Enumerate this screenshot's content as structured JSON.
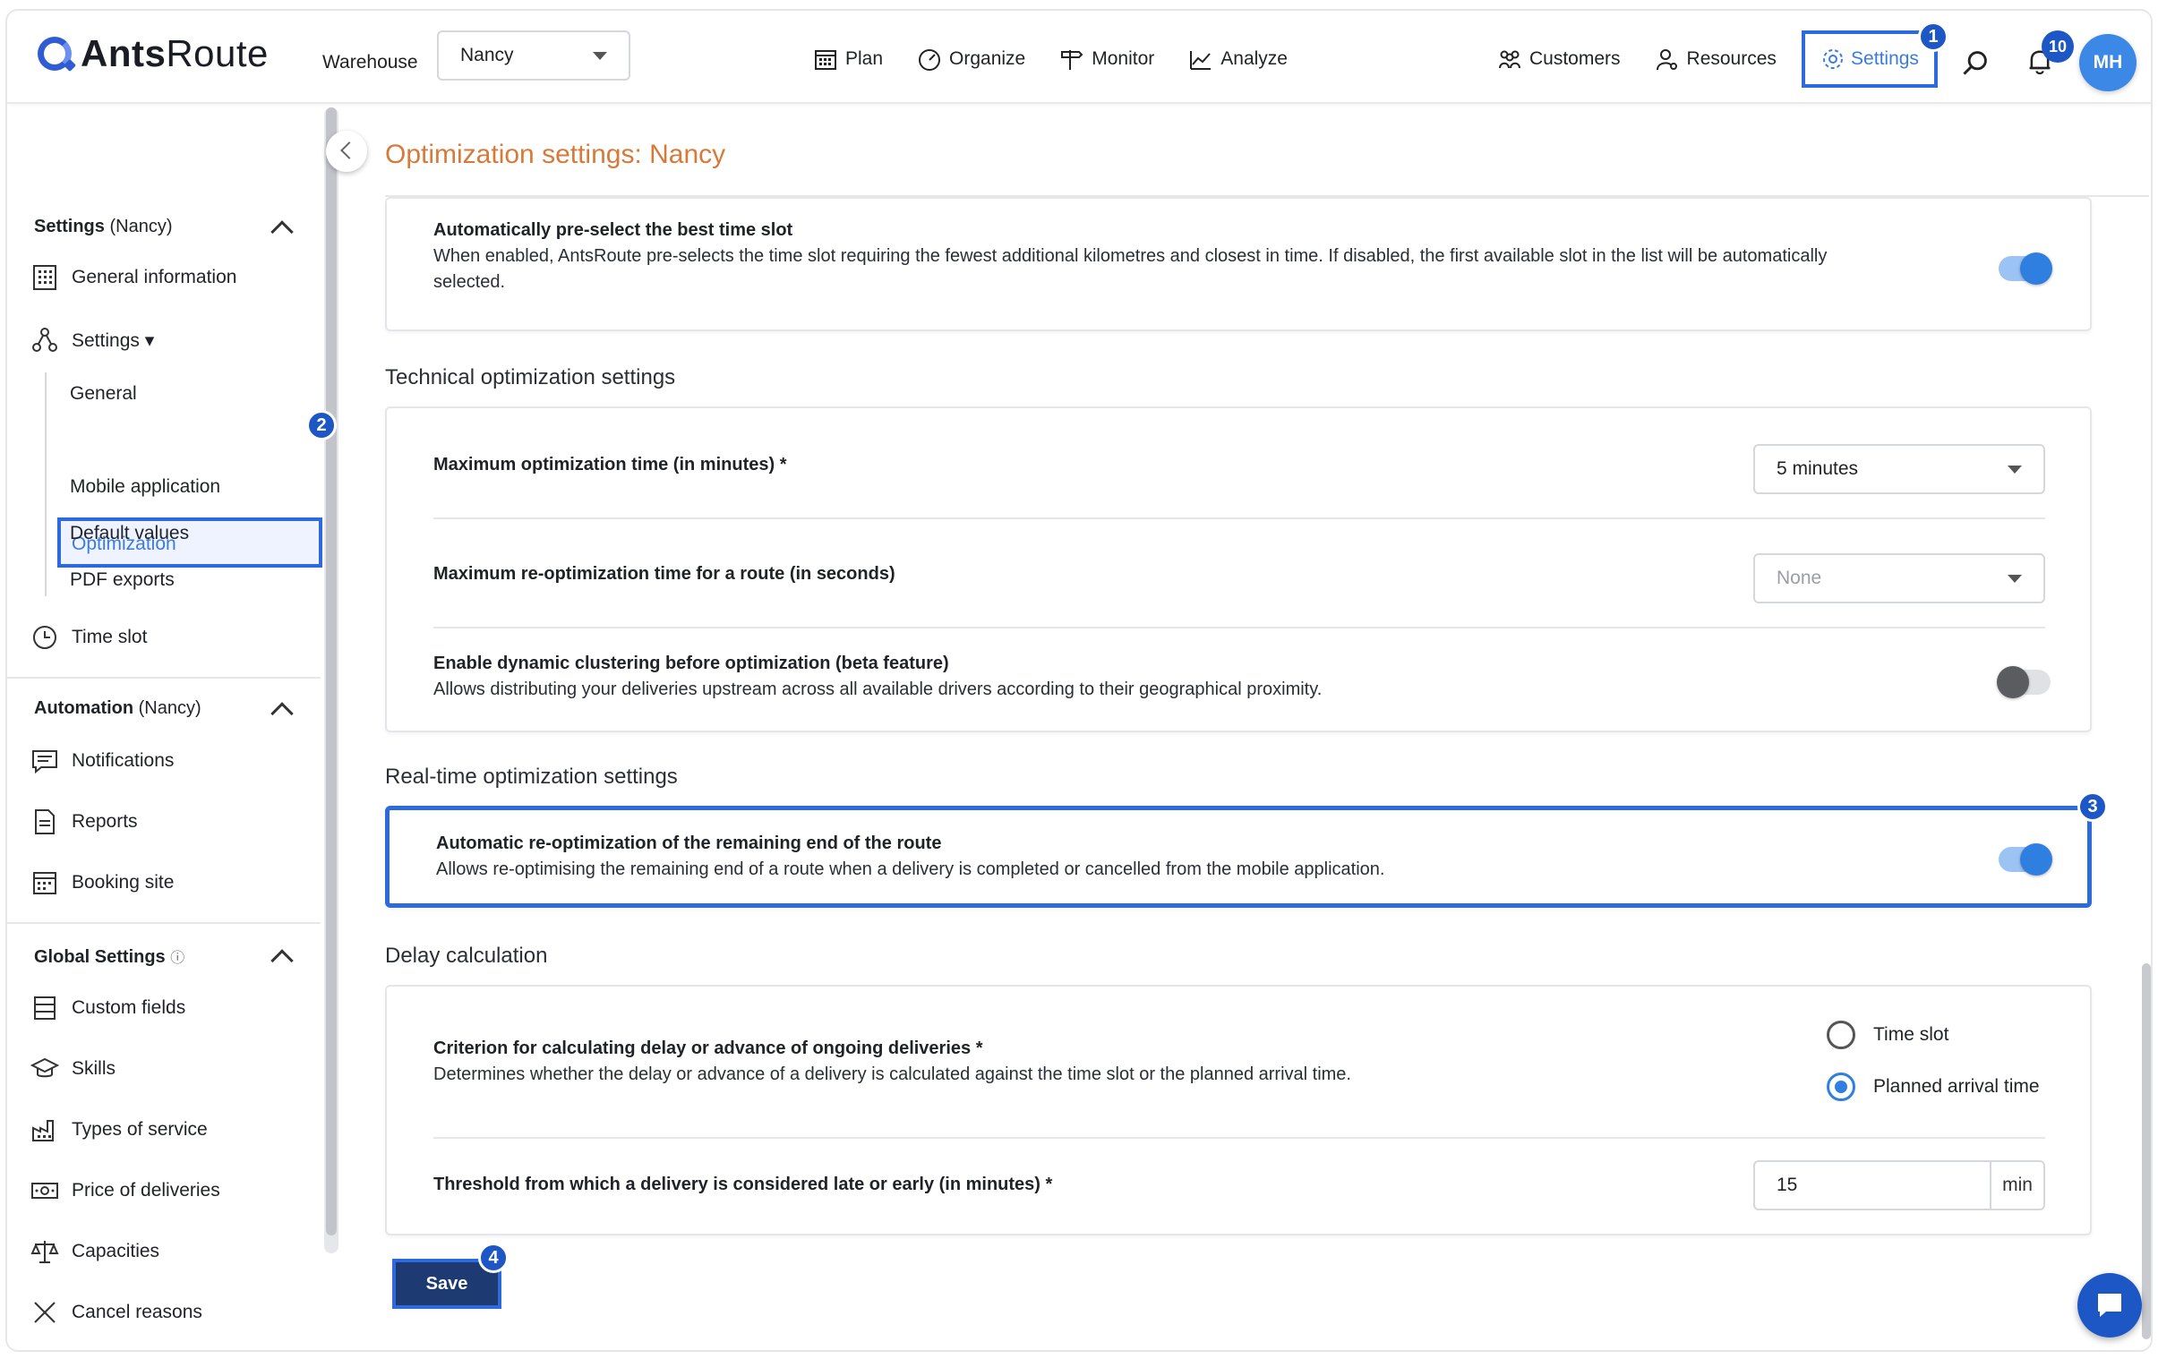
{
  "brand": {
    "name_bold": "Ants",
    "name_rest": "Route"
  },
  "topbar": {
    "warehouse_label": "Warehouse",
    "warehouse_value": "Nancy",
    "nav": [
      {
        "label": "Plan",
        "icon": "calendar-icon"
      },
      {
        "label": "Organize",
        "icon": "gauge-icon"
      },
      {
        "label": "Monitor",
        "icon": "signpost-icon"
      },
      {
        "label": "Analyze",
        "icon": "chart-icon"
      }
    ],
    "right_nav": [
      {
        "label": "Customers",
        "icon": "customers-icon"
      },
      {
        "label": "Resources",
        "icon": "resources-icon"
      }
    ],
    "settings_label": "Settings",
    "notifications_count": "10",
    "avatar_initials": "MH"
  },
  "steps": {
    "s1": "1",
    "s2": "2",
    "s3": "3",
    "s4": "4"
  },
  "sidebar": {
    "settings_head_bold": "Settings",
    "settings_head_rest": " (Nancy)",
    "general_information": "General information",
    "settings_group": "Settings ▾",
    "sub_items": [
      "General",
      "Optimization",
      "Mobile application",
      "Default values",
      "PDF exports"
    ],
    "time_slot": "Time slot",
    "automation_head_bold": "Automation",
    "automation_head_rest": " (Nancy)",
    "automation_items": [
      "Notifications",
      "Reports",
      "Booking site"
    ],
    "global_head_bold": "Global Settings",
    "global_info": "ⓘ",
    "global_items": [
      "Custom fields",
      "Skills",
      "Types of service",
      "Price of deliveries",
      "Capacities",
      "Cancel reasons"
    ]
  },
  "main": {
    "title": "Optimization settings: Nancy",
    "preselect": {
      "title": "Automatically pre-select the best time slot",
      "desc": "When enabled, AntsRoute pre-selects the time slot requiring the fewest additional kilometres and closest in time. If disabled, the first available slot in the list will be automatically selected.",
      "enabled": true
    },
    "technical_label": "Technical optimization settings",
    "max_opt_time": {
      "title": "Maximum optimization time (in minutes) *",
      "value": "5 minutes"
    },
    "max_reopt_time": {
      "title": "Maximum re-optimization time for a route (in seconds)",
      "value": "None"
    },
    "dynamic_clustering": {
      "title": "Enable dynamic clustering before optimization (beta feature)",
      "desc": "Allows distributing your deliveries upstream across all available drivers according to their geographical proximity.",
      "enabled": false
    },
    "realtime_label": "Real-time optimization settings",
    "auto_reopt": {
      "title": "Automatic re-optimization of the remaining end of the route",
      "desc": "Allows re-optimising the remaining end of a route when a delivery is completed or cancelled from the mobile application.",
      "enabled": true
    },
    "delay_label": "Delay calculation",
    "criterion": {
      "title": "Criterion for calculating delay or advance of ongoing deliveries *",
      "desc": "Determines whether the delay or advance of a delivery is calculated against the time slot or the planned arrival time.",
      "options": [
        "Time slot",
        "Planned arrival time"
      ],
      "selected": "Planned arrival time"
    },
    "threshold": {
      "title": "Threshold from which a delivery is considered late or early (in minutes) *",
      "value": "15",
      "unit": "min"
    },
    "save_label": "Save"
  },
  "colors": {
    "accent": "#2d6bdc",
    "title_orange": "#d67a3a",
    "save_bg": "#1e3a73"
  }
}
